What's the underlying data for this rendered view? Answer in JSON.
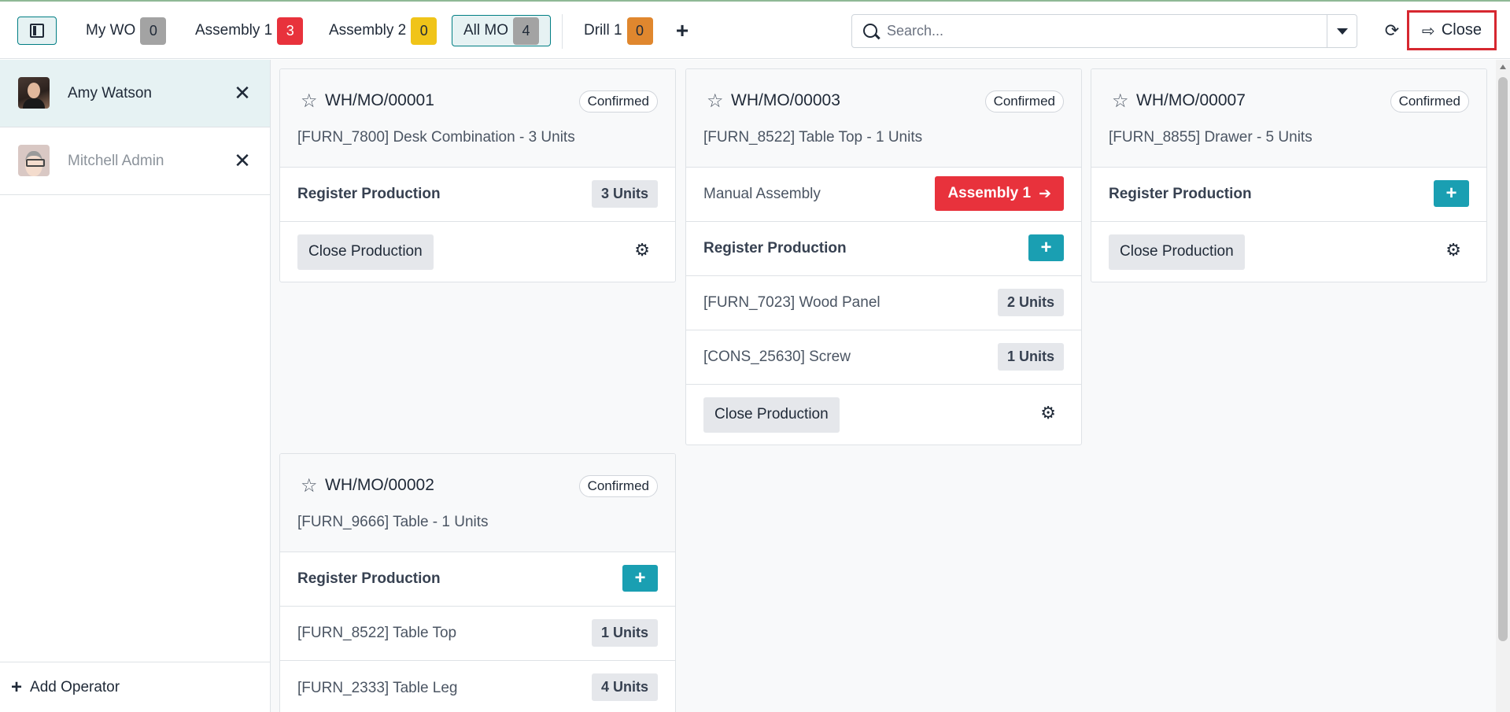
{
  "workcenter_tabs": [
    {
      "label": "My WO",
      "count": "0",
      "color": "#a3a3a3"
    },
    {
      "label": "Assembly 1",
      "count": "3",
      "color": "#e8323c"
    },
    {
      "label": "Assembly 2",
      "count": "0",
      "color": "#f0c419"
    },
    {
      "label": "All MO",
      "count": "4",
      "color": "#a3a3a3",
      "active": true
    },
    {
      "label": "Drill 1",
      "count": "0",
      "color": "#e0872e"
    }
  ],
  "add_workcenter_label": "+",
  "search": {
    "placeholder": "Search..."
  },
  "close_label": "Close",
  "operators": [
    {
      "name": "Amy Watson",
      "active": true
    },
    {
      "name": "Mitchell Admin",
      "active": false
    }
  ],
  "add_operator_label": "Add Operator",
  "cards": [
    {
      "name": "WH/MO/00001",
      "status": "Confirmed",
      "product": "[FURN_7800] Desk Combination - 3 Units",
      "register_label": "Register Production",
      "register_units": "3 Units",
      "close_label": "Close Production"
    },
    {
      "name": "WH/MO/00003",
      "status": "Confirmed",
      "product": "[FURN_8522] Table Top - 1 Units",
      "operation": "Manual Assembly",
      "operation_wc": "Assembly 1",
      "register_label": "Register Production",
      "components": [
        {
          "name": "[FURN_7023] Wood Panel",
          "qty": "2 Units"
        },
        {
          "name": "[CONS_25630] Screw",
          "qty": "1 Units"
        }
      ],
      "close_label": "Close Production"
    },
    {
      "name": "WH/MO/00007",
      "status": "Confirmed",
      "product": "[FURN_8855] Drawer - 5 Units",
      "register_label": "Register Production",
      "close_label": "Close Production"
    },
    {
      "name": "WH/MO/00002",
      "status": "Confirmed",
      "product": "[FURN_9666] Table - 1 Units",
      "register_label": "Register Production",
      "components": [
        {
          "name": "[FURN_8522] Table Top",
          "qty": "1 Units"
        },
        {
          "name": "[FURN_2333] Table Leg",
          "qty": "4 Units"
        }
      ]
    }
  ],
  "colors": {
    "accent": "#017e84",
    "plus_button": "#1a9fb2",
    "workcenter_button": "#e8323c",
    "highlight_border": "#d62730"
  }
}
